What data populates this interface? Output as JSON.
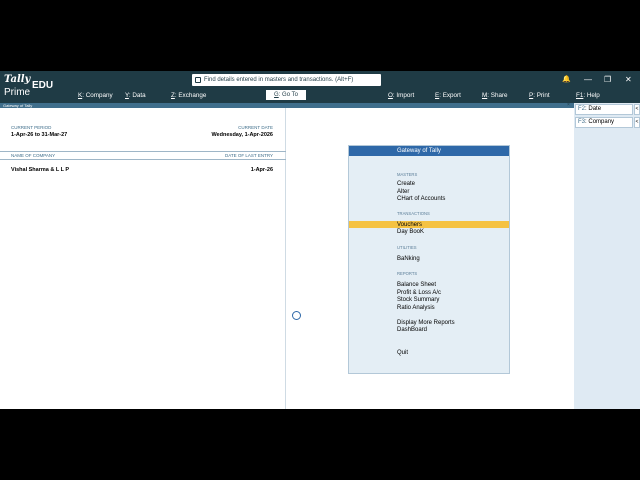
{
  "header": {
    "logo_line1": "Tally",
    "logo_line2": "Prime",
    "edition": "EDU",
    "search_placeholder": "Find details entered in masters and transactions. (Alt+F)",
    "menu": [
      {
        "key": "K",
        "label": "Company"
      },
      {
        "key": "Y",
        "label": "Data"
      },
      {
        "key": "Z",
        "label": "Exchange"
      },
      {
        "key": "G",
        "label": "Go To"
      },
      {
        "key": "O",
        "label": "Import"
      },
      {
        "key": "E",
        "label": "Export"
      },
      {
        "key": "M",
        "label": "Share"
      },
      {
        "key": "P",
        "label": "Print"
      },
      {
        "key": "F1",
        "label": "Help"
      }
    ],
    "window_controls": {
      "bell": "🔔",
      "minimize": "—",
      "restore": "❐",
      "close": "✕"
    }
  },
  "title_strip": {
    "title": "Gateway of Tally",
    "close": "×"
  },
  "left_pane": {
    "current_period_label": "CURRENT PERIOD",
    "current_period_value": "1-Apr-26 to 31-Mar-27",
    "current_date_label": "CURRENT DATE",
    "current_date_value": "Wednesday, 1-Apr-2026",
    "company_name_label": "NAME OF COMPANY",
    "last_entry_label": "DATE OF LAST ENTRY",
    "company_name": "Vishal Sharma & L L P",
    "last_entry_date": "1-Apr-26"
  },
  "gateway": {
    "title": "Gateway of Tally",
    "masters_label": "MASTERS",
    "masters": [
      "Create",
      "Alter",
      "CHart of Accounts"
    ],
    "transactions_label": "TRANSACTIONS",
    "transactions": [
      "Vouchers",
      "Day BooK"
    ],
    "utilities_label": "UTILITIES",
    "utilities": [
      "BaNking"
    ],
    "reports_label": "REPORTS",
    "reports": [
      "Balance Sheet",
      "Profit & Loss A/c",
      "Stock Summary",
      "Ratio Analysis"
    ],
    "more": [
      "Display More Reports",
      "DashBoard"
    ],
    "quit": "Quit"
  },
  "right_bar": [
    {
      "key": "F2",
      "label": "Date",
      "arrow": "<"
    },
    {
      "key": "F3",
      "label": "Company",
      "arrow": "<"
    }
  ],
  "colors": {
    "header_bg": "#1f3b45",
    "highlight": "#f5c242",
    "gateway_title": "#2e68a8"
  }
}
